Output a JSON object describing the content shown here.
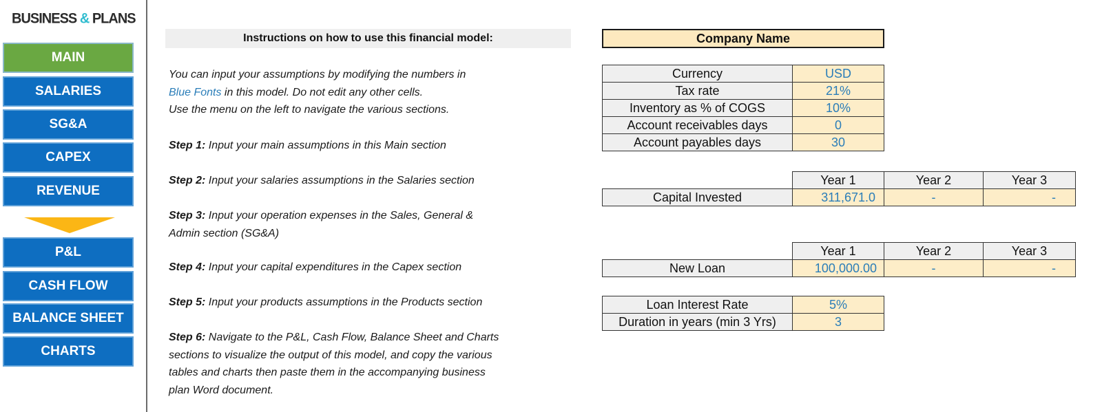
{
  "logo": {
    "part1": "BUSINESS ",
    "amp": "&",
    "part2": " PLANS"
  },
  "colors": {
    "nav_blue": "#0e6ec1",
    "nav_active_green": "#6aa842",
    "arrow_yellow": "#fbb615",
    "input_blue_font": "#2a7db8",
    "input_cell_bg": "#fdedc8",
    "label_cell_bg": "#efefef",
    "logo_accent": "#2fbccf"
  },
  "nav": {
    "items": [
      {
        "label": "MAIN",
        "active": true
      },
      {
        "label": "SALARIES"
      },
      {
        "label": "SG&A"
      },
      {
        "label": "CAPEX"
      },
      {
        "label": "REVENUE"
      },
      {
        "label": "P&L"
      },
      {
        "label": "CASH FLOW"
      },
      {
        "label": "BALANCE SHEET"
      },
      {
        "label": "CHARTS"
      }
    ],
    "arrow_icon": "down-arrow-icon"
  },
  "instructions": {
    "header": "Instructions on how to use this financial model:",
    "intro_line1": "You can input your assumptions by modifying the numbers in",
    "intro_blue": "Blue Fonts",
    "intro_line2_rest": " in this model. Do not edit any other cells.",
    "intro_line3": "Use the menu on the left to navigate the various sections.",
    "steps": [
      {
        "label": "Step 1:",
        "text": " Input your main assumptions in this Main section"
      },
      {
        "label": "Step 2:",
        "text": " Input your salaries assumptions in the Salaries section"
      },
      {
        "label": "Step 3:",
        "text": " Input your operation expenses in the Sales, General &",
        "text2": "Admin section (SG&A)"
      },
      {
        "label": "Step 4:",
        "text": " Input your capital expenditures in the Capex section"
      },
      {
        "label": "Step 5:",
        "text": " Input your products assumptions in the Products section"
      },
      {
        "label": "Step 6:",
        "text": " Navigate to the P&L, Cash Flow, Balance Sheet and Charts",
        "text2": "sections to visualize the output of this model, and copy the various",
        "text3": "tables and charts then paste them in the accompanying business",
        "text4": "plan Word document."
      }
    ]
  },
  "company_name": "Company Name",
  "assumptions": [
    {
      "label": "Currency",
      "value": "USD"
    },
    {
      "label": "Tax rate",
      "value": "21%"
    },
    {
      "label": "Inventory as % of COGS",
      "value": "10%"
    },
    {
      "label": "Account receivables days",
      "value": "0"
    },
    {
      "label": "Account payables days",
      "value": "30"
    }
  ],
  "capital": {
    "headers": [
      "Year 1",
      "Year 2",
      "Year 3"
    ],
    "label": "Capital Invested",
    "values": [
      "311,671.0",
      "-",
      "-"
    ]
  },
  "loan": {
    "headers": [
      "Year 1",
      "Year 2",
      "Year 3"
    ],
    "label": "New Loan",
    "values": [
      "100,000.00",
      "-",
      "-"
    ]
  },
  "loan_terms": [
    {
      "label": "Loan Interest Rate",
      "value": "5%"
    },
    {
      "label": "Duration in years (min 3 Yrs)",
      "value": "3"
    }
  ]
}
